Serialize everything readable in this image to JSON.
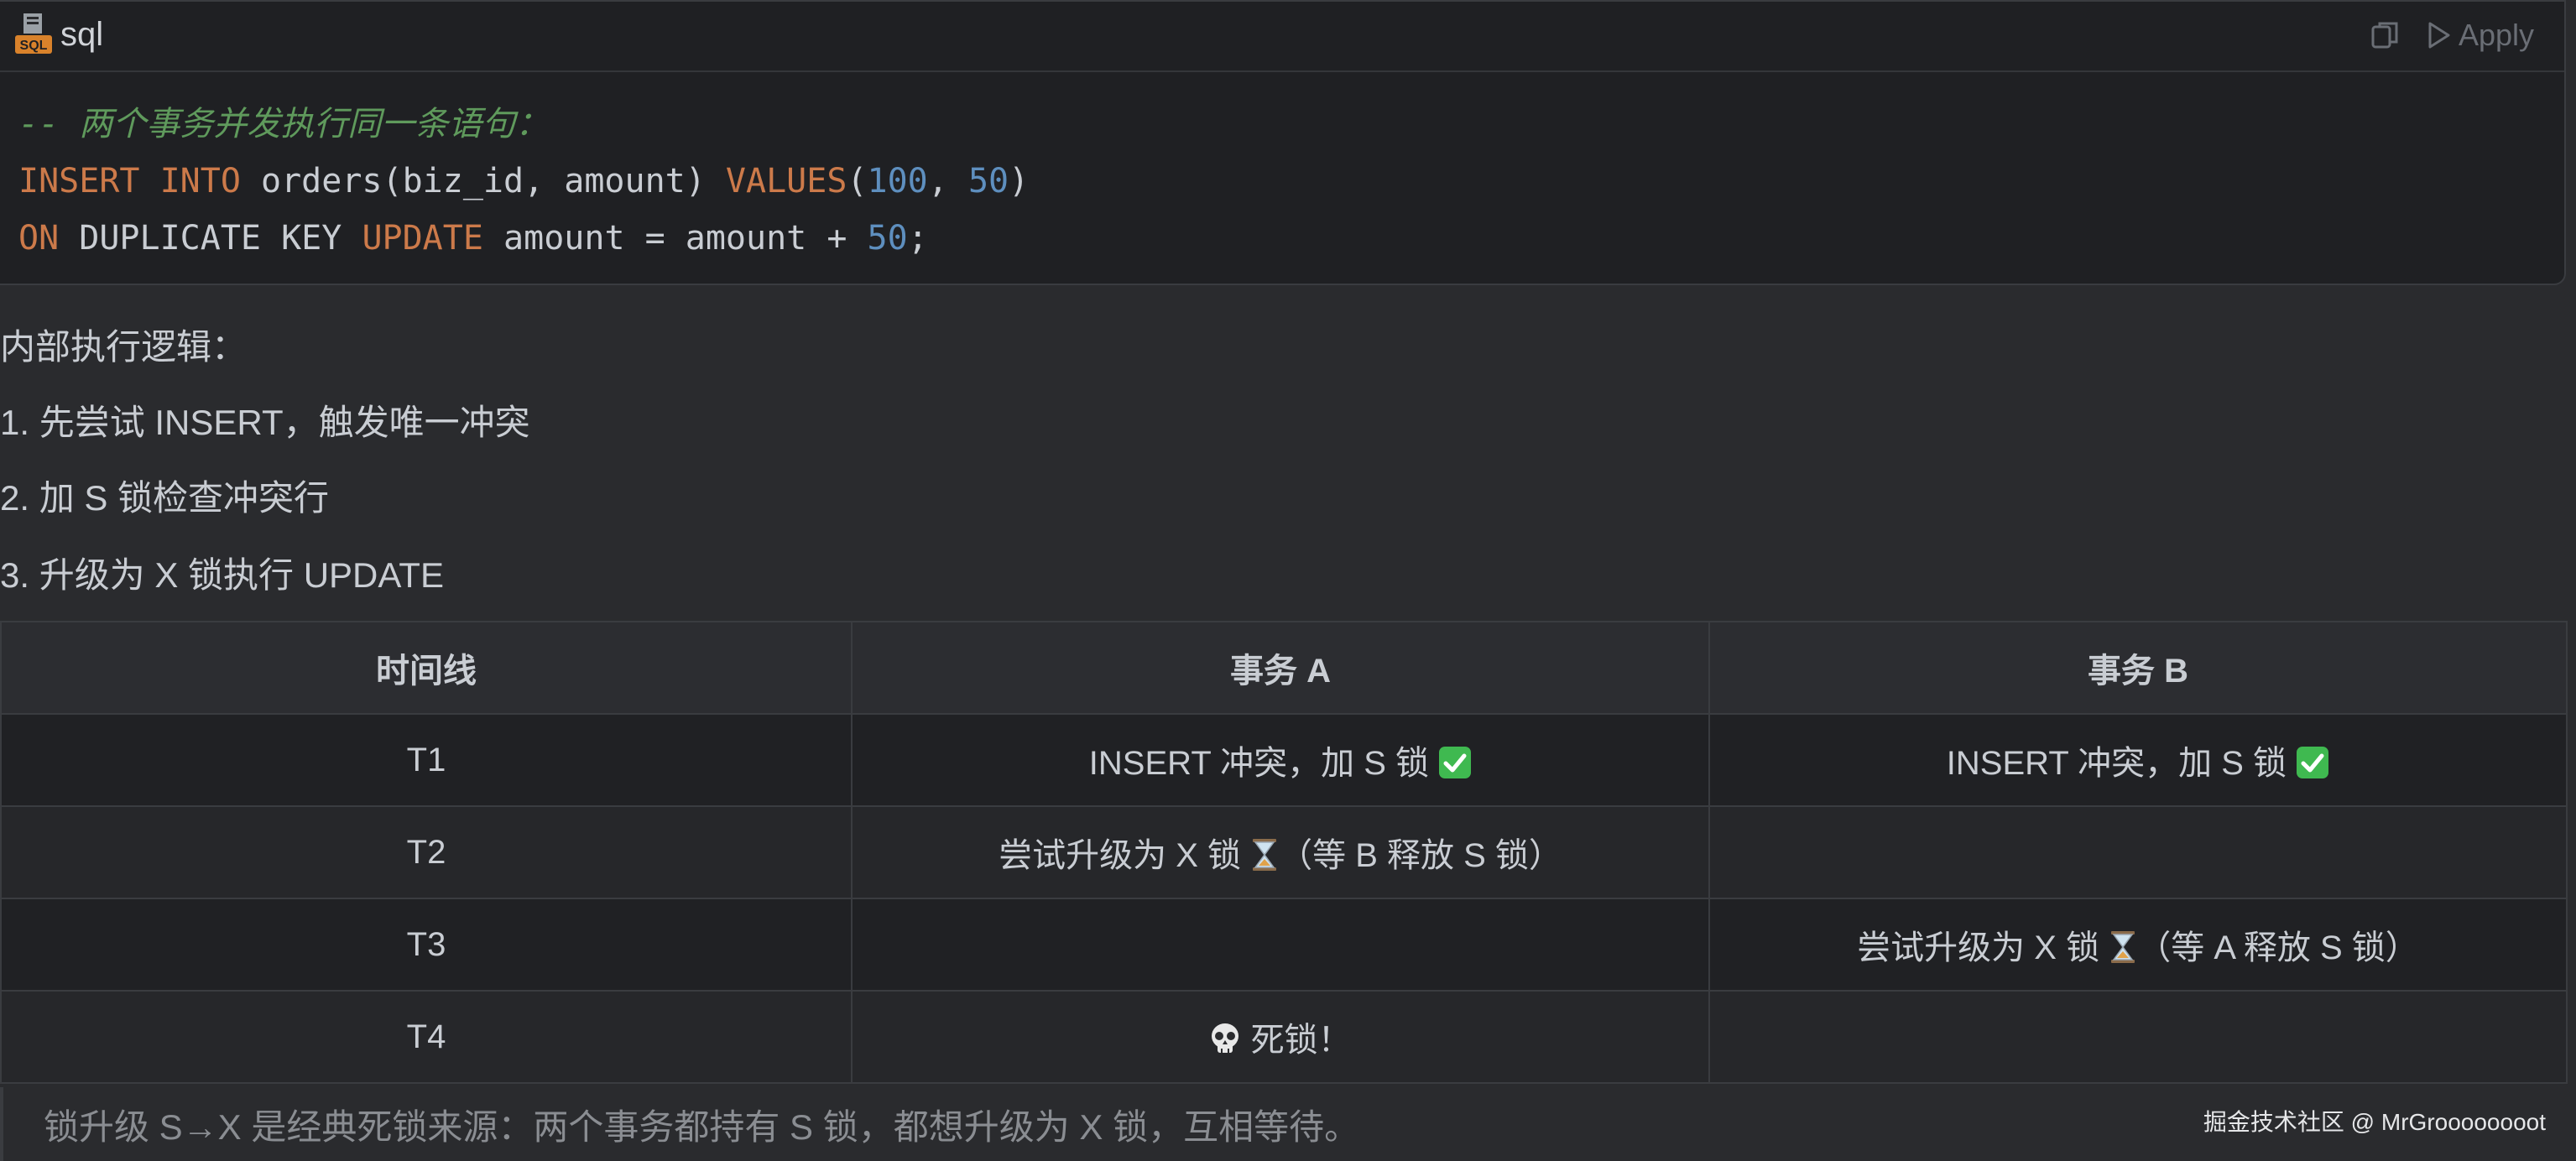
{
  "code_block": {
    "language": "sql",
    "apply_label": "Apply",
    "lines": {
      "comment": "-- 两个事务并发执行同一条语句：",
      "l2": {
        "kw1": "INSERT",
        "kw2": "INTO",
        "table": "orders(biz_id, amount)",
        "kw3": "VALUES",
        "open": "(",
        "n1": "100",
        "sep": ", ",
        "n2": "50",
        "close": ")"
      },
      "l3": {
        "kw1": "ON",
        "mid": "DUPLICATE KEY",
        "kw2": "UPDATE",
        "expr": "amount = amount + ",
        "n1": "50",
        "end": ";"
      }
    }
  },
  "text": {
    "heading": "内部执行逻辑：",
    "step1": "1. 先尝试 INSERT，触发唯一冲突",
    "step2": "2. 加 S 锁检查冲突行",
    "step3": "3. 升级为 X 锁执行 UPDATE"
  },
  "table": {
    "headers": [
      "时间线",
      "事务 A",
      "事务 B"
    ],
    "rows": [
      [
        "T1",
        "INSERT 冲突，加 S 锁",
        "INSERT 冲突，加 S 锁"
      ],
      [
        "T2",
        "尝试升级为 X 锁",
        ""
      ],
      [
        "T3",
        "",
        "尝试升级为 X 锁"
      ],
      [
        "T4",
        "死锁！",
        ""
      ]
    ],
    "t2_a_suffix": "（等 B 释放 S 锁）",
    "t3_b_suffix": "（等 A 释放 S 锁）"
  },
  "footer": "锁升级 S→X 是经典死锁来源：两个事务都持有 S 锁，都想升级为 X 锁，互相等待。",
  "watermark": "掘金技术社区 @ MrGroooooooot",
  "icons": [
    "sql-file-icon",
    "copy-icon",
    "play-icon",
    "check-mark-icon",
    "hourglass-icon",
    "skull-icon"
  ],
  "colors": {
    "keyword": "#cc7a4a",
    "number": "#5e8fbf",
    "comment": "#5f9a5c",
    "check": "#3fb950"
  }
}
